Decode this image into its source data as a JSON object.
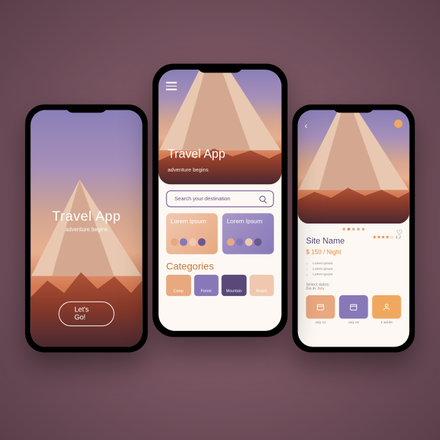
{
  "splash": {
    "title": "Travel App",
    "subtitle": "adventure begins",
    "cta": "Let's Go!"
  },
  "home": {
    "title": "Travel App",
    "subtitle": "adventure begins",
    "search_placeholder": "Search your destination",
    "cards": [
      {
        "label": "Lorem Ipsum"
      },
      {
        "label": "Lorem Ipsum"
      }
    ],
    "categories_title": "Categories",
    "categories": [
      {
        "label": "Camp"
      },
      {
        "label": "Forest"
      },
      {
        "label": "Mountain"
      },
      {
        "label": "Beach"
      }
    ]
  },
  "detail": {
    "site_name": "Site Name",
    "rating_value": "4.2",
    "price": "$ 150 / Night",
    "bullets": [
      "Lorem ipsum",
      "Lorem ipsum",
      "Lorem ipsum"
    ],
    "select_dates_label": "Select dates:",
    "go_in_prefix": "Go in ",
    "go_in_month": "July",
    "date1": "July 12",
    "date2": "July 18",
    "guests": "2 adults"
  }
}
